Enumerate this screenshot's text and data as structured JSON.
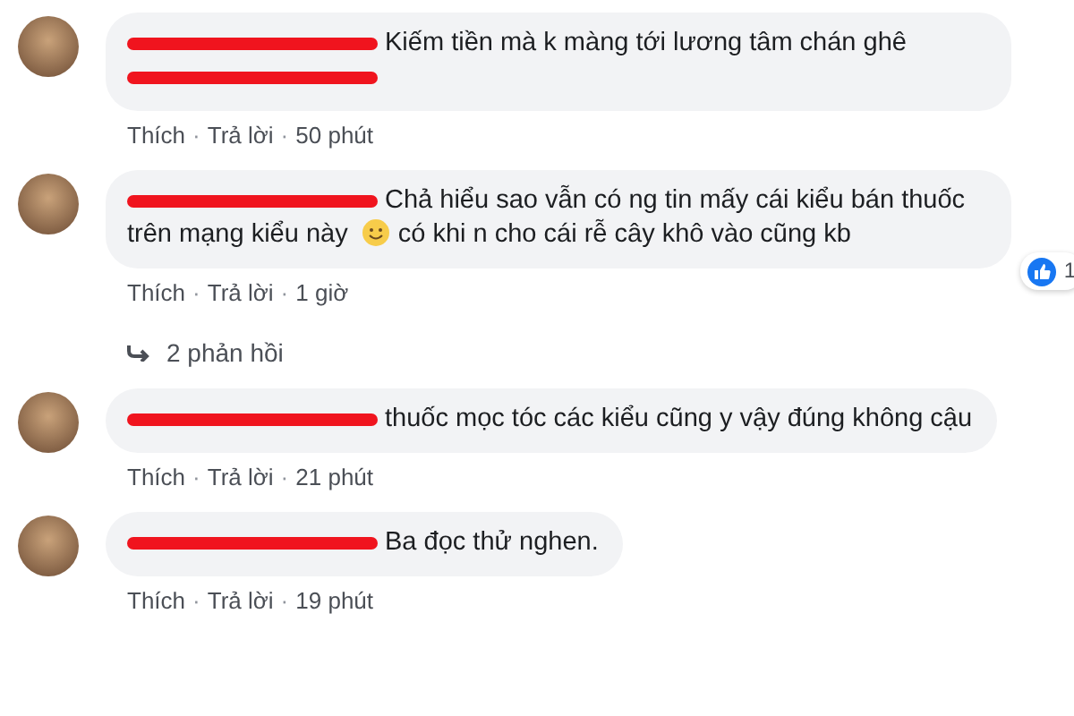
{
  "separator": "·",
  "comments": [
    {
      "parts": [
        {
          "kind": "redaction"
        },
        {
          "kind": "text",
          "text": "Kiếm tiền mà k màng tới lương tâm chán ghê"
        },
        {
          "kind": "redaction"
        }
      ],
      "actions": [
        "Thích",
        "Trả lời",
        "50 phút"
      ]
    },
    {
      "parts": [
        {
          "kind": "redaction"
        },
        {
          "kind": "text",
          "text": "Chả hiểu sao vẫn có ng tin mấy cái kiểu bán thuốc trên mạng kiểu này"
        },
        {
          "kind": "emoji"
        },
        {
          "kind": "text",
          "text": "có khi n cho cái rễ cây khô vào cũng kb"
        }
      ],
      "actions": [
        "Thích",
        "Trả lời",
        "1 giờ"
      ],
      "reaction": {
        "count": "1"
      },
      "replies": "2 phản hồi"
    },
    {
      "parts": [
        {
          "kind": "redaction"
        },
        {
          "kind": "text",
          "text": "thuốc mọc tóc các kiểu cũng y vậy đúng không cậu"
        }
      ],
      "actions": [
        "Thích",
        "Trả lời",
        "21 phút"
      ]
    },
    {
      "parts": [
        {
          "kind": "redaction"
        },
        {
          "kind": "text",
          "text": "Ba đọc thử nghen."
        }
      ],
      "actions": [
        "Thích",
        "Trả lời",
        "19 phút"
      ]
    }
  ]
}
